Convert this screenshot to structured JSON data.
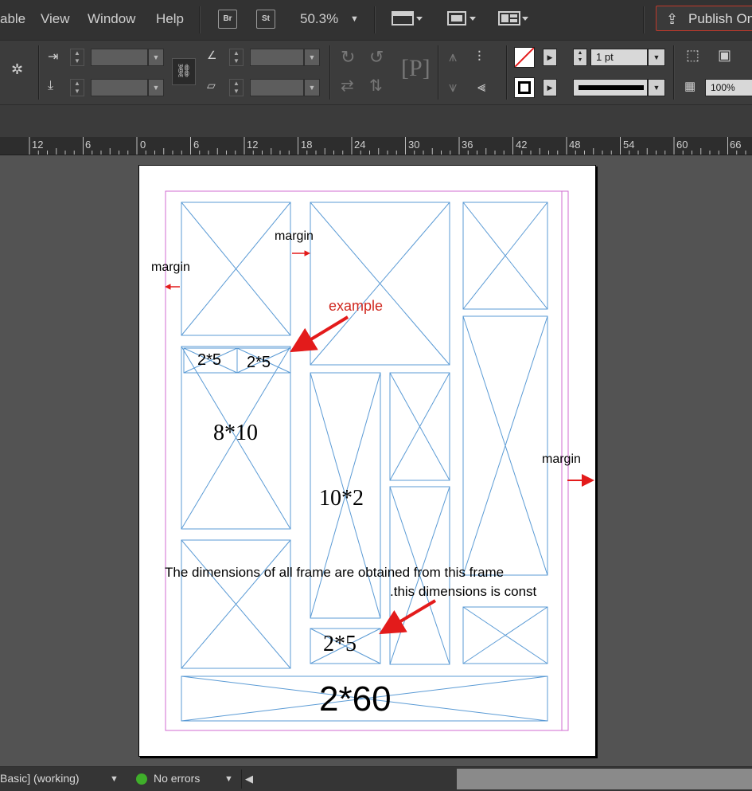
{
  "menu": {
    "items": [
      "able",
      "View",
      "Window",
      "Help"
    ],
    "bridge_label": "Br",
    "stock_label": "St",
    "zoom": "50.3%",
    "publish_label": "Publish Onl"
  },
  "control": {
    "stroke_weight": "1 pt",
    "opacity": "100%"
  },
  "ruler": {
    "ticks": [
      "12",
      "6",
      "0",
      "6",
      "12",
      "18",
      "24",
      "30",
      "36",
      "42",
      "48",
      "54",
      "60",
      "66"
    ]
  },
  "status": {
    "profile": "Basic] (working)",
    "preflight": "No errors"
  },
  "annotations": {
    "margin_left": "margin",
    "margin_mid": "margin",
    "margin_right": "margin",
    "example": "example",
    "dim_2x5_a": "2*5",
    "dim_2x5_b": "2*5",
    "dim_8x10": "8*10",
    "dim_10x2": "10*2",
    "note_line1": "The dimensions of all frame  are obtained from this frame",
    "note_line2": ".this dimensions  is const",
    "dim_2x5_c": "2*5",
    "dim_2x60": "2*60"
  },
  "colors": {
    "frame_stroke": "#5b9bd5",
    "margin_guide": "#d16bd1",
    "arrow": "#e31b1b",
    "example_text": "#d0281f",
    "publish_border": "#c0392b",
    "preflight_ok": "#3fae2a"
  }
}
